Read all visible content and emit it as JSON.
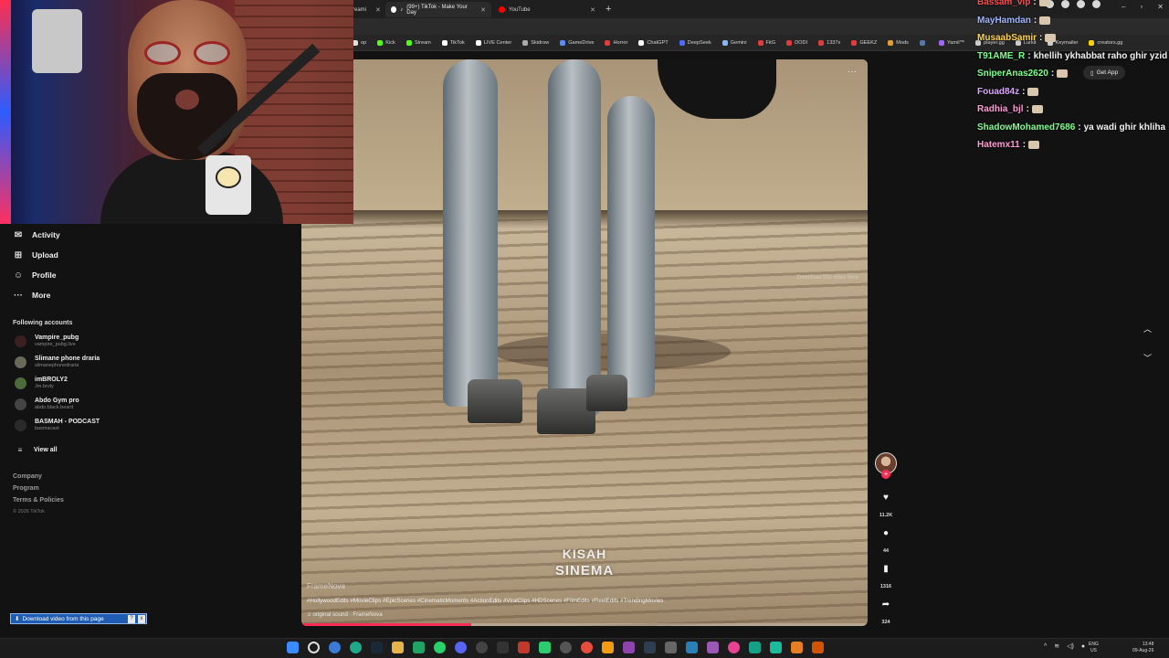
{
  "browser": {
    "tabs": [
      {
        "label": "reami",
        "active": false
      },
      {
        "label": "(99+) TikTok - Make Your Day",
        "active": true
      },
      {
        "label": "YouTube",
        "active": false
      }
    ],
    "new_tab": "+",
    "window_controls": [
      "–",
      "▫",
      "✕"
    ],
    "bookmarks": [
      {
        "label": "op",
        "color": "#e0e0e0"
      },
      {
        "label": "Kick",
        "color": "#53fc18"
      },
      {
        "label": "Stream",
        "color": "#53fc18"
      },
      {
        "label": "TikTok",
        "color": "#ffffff"
      },
      {
        "label": "LIVE Center",
        "color": "#ffffff"
      },
      {
        "label": "Skidrow",
        "color": "#aaaaaa"
      },
      {
        "label": "GameDrive",
        "color": "#5d8bff"
      },
      {
        "label": "Horror",
        "color": "#e23b3b"
      },
      {
        "label": "ChatGPT",
        "color": "#ffffff"
      },
      {
        "label": "DeepSeek",
        "color": "#4d6bfe"
      },
      {
        "label": "Gemini",
        "color": "#8ab4f8"
      },
      {
        "label": "FitG",
        "color": "#e23b3b"
      },
      {
        "label": "DODI",
        "color": "#e23b3b"
      },
      {
        "label": "1337x",
        "color": "#e23b3b"
      },
      {
        "label": "GEEKZ",
        "color": "#e23b3b"
      },
      {
        "label": "Mods",
        "color": "#e0a030"
      },
      {
        "label": "",
        "color": "#5577aa"
      },
      {
        "label": "Yamil™",
        "color": "#a066ff"
      },
      {
        "label": "player.gg",
        "color": "#cccccc"
      },
      {
        "label": "Lurkit",
        "color": "#cccccc"
      },
      {
        "label": "Keymailer",
        "color": "#cccccc"
      },
      {
        "label": "creators.gg",
        "color": "#ffd400"
      }
    ]
  },
  "sidebar": {
    "nav": [
      {
        "label": "Activity",
        "icon": "activity-icon",
        "glyph": "✉"
      },
      {
        "label": "Upload",
        "icon": "upload-icon",
        "glyph": "⊞"
      },
      {
        "label": "Profile",
        "icon": "profile-icon",
        "glyph": "☺"
      },
      {
        "label": "More",
        "icon": "more-icon",
        "glyph": "···"
      }
    ],
    "following_title": "Following accounts",
    "accounts": [
      {
        "name": "Vampire_pubg",
        "handle": "vampire_pubg.live"
      },
      {
        "name": "Slimane phone draria",
        "handle": "slimanephonedraria"
      },
      {
        "name": "imBROLY2",
        "handle": "Jm.broly"
      },
      {
        "name": "Abdo Gym pro",
        "handle": "abdo.black.beard"
      },
      {
        "name": "BASMAH - PODCAST",
        "handle": "basmacast"
      }
    ],
    "view_all": "View all",
    "footer_links": [
      "Company",
      "Program",
      "Terms & Policies"
    ],
    "copyright": "© 2026 TikTok"
  },
  "video": {
    "more_glyph": "···",
    "overlay_text": "Download this video here",
    "watermark_line1": "KISAH",
    "watermark_line2": "SINEMA",
    "author": "FrameNova",
    "hashtags": "#HollywoodEdits #MovieClips #EpicScenes #CinematicMoments #ActionEdits #ViralClips #HDScenes #FilmEdits #ReelEdits #TrendingMovies",
    "sound": "♫  original sound · FrameNova",
    "progress": 0.3
  },
  "actions": {
    "like_count": "11.2K",
    "comment_count": "44",
    "save_count": "1316",
    "share_count": "324"
  },
  "chat": {
    "messages": [
      {
        "user": "Bassam_vip",
        "text": "",
        "color": "#ff4b4b"
      },
      {
        "user": "MayHamdan",
        "text": "",
        "color": "#9fb4ff"
      },
      {
        "user": "MusaabSamir",
        "text": "",
        "color": "#ffd34d"
      },
      {
        "user": "T91AME_R",
        "text": "khellih ykhabbat raho ghir yzid",
        "color": "#7dff8a"
      },
      {
        "user": "SniperAnas2620",
        "text": "",
        "color": "#7dff8a"
      },
      {
        "user": "Fouad84z",
        "text": "",
        "color": "#d9a6ff"
      },
      {
        "user": "Radhia_bjl",
        "text": "",
        "color": "#ff9ad5"
      },
      {
        "user": "ShadowMohamed7686",
        "text": "ya wadi ghir khliha",
        "color": "#7dff8a"
      },
      {
        "user": "Hatemx11",
        "text": "",
        "color": "#ff9ad5"
      }
    ],
    "get_app": "Get App"
  },
  "download_bar": {
    "label": "Download video from this page",
    "help": "?",
    "close": "x"
  },
  "taskbar": {
    "lang_line1": "ENG",
    "lang_line2": "US",
    "time": "13:48",
    "date": "09-Aug-26"
  }
}
